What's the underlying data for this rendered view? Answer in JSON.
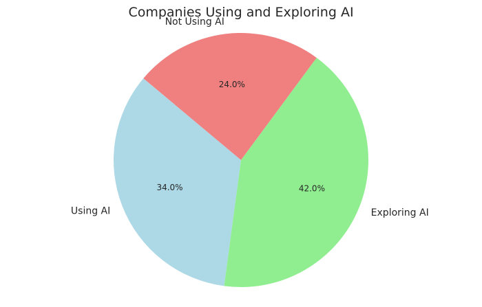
{
  "chart_data": {
    "type": "pie",
    "title": "Companies Using and Exploring AI",
    "slices": [
      {
        "label": "Using AI",
        "value": 34.0,
        "pct_label": "34.0%",
        "color": "#ADD8E6"
      },
      {
        "label": "Exploring AI",
        "value": 42.0,
        "pct_label": "42.0%",
        "color": "#90EE90"
      },
      {
        "label": "Not Using AI",
        "value": 24.0,
        "pct_label": "24.0%",
        "color": "#F08080"
      }
    ],
    "start_angle_deg": 140,
    "direction": "counterclockwise",
    "legend": "none"
  }
}
